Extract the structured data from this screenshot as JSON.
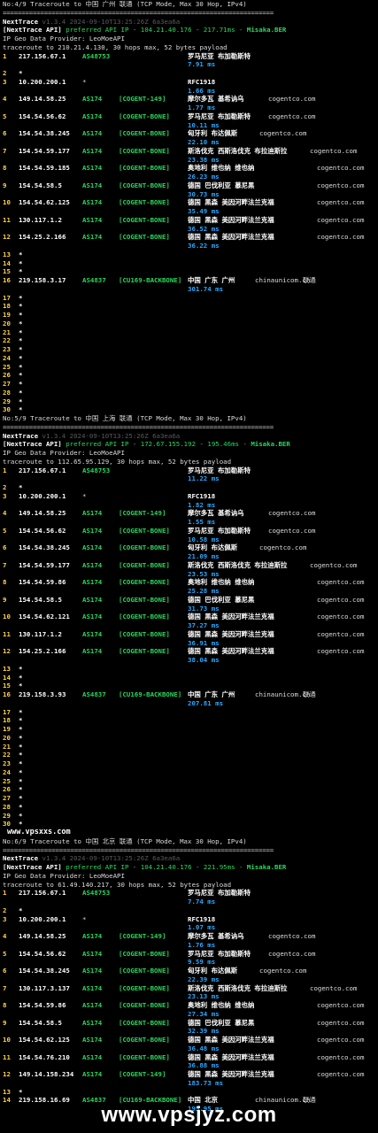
{
  "blocks": [
    {
      "header": "No:4/9 Traceroute to 中国 广州 联通 (TCP Mode, Max 30 Hop, IPv4)",
      "separator": "========================================================================",
      "title": "NextTrace",
      "version": "v1.3.4 2024-09-10T13:25:26Z 6a3ea6a",
      "api_prefix": "[NextTrace API]",
      "api_text": " preferred API IP - 104.21.40.176 - 217.71ms - ",
      "api_node": "Misaka.BER",
      "geo_provider": "IP Geo Data Provider: LeoMoeAPI",
      "trace_line": "traceroute to 210.21.4.130, 30 hops max, 52 bytes payload",
      "hops": [
        {
          "n": "1",
          "ip": "217.156.67.1",
          "as": "AS48753",
          "tag": "",
          "loc": "罗马尼亚 布加勒斯特",
          "dom": "",
          "isp": "",
          "ms": "7.91 ms"
        },
        {
          "n": "2",
          "ip": "*"
        },
        {
          "n": "3",
          "ip": "10.200.200.1",
          "as": "*",
          "tag": "",
          "loc": "RFC1918",
          "dom": "",
          "isp": "",
          "ms": "1.66 ms"
        },
        {
          "n": "4",
          "ip": "149.14.58.25",
          "as": "AS174",
          "tag": "[COGENT-149]",
          "loc": "摩尔多瓦 基希讷乌",
          "dom": "cogentco.com",
          "isp": "",
          "ms": "1.77 ms"
        },
        {
          "n": "5",
          "ip": "154.54.56.62",
          "as": "AS174",
          "tag": "[COGENT-BONE]",
          "loc": "罗马尼亚 布加勒斯特",
          "dom": "cogentco.com",
          "isp": "",
          "ms": "10.11 ms"
        },
        {
          "n": "6",
          "ip": "154.54.38.245",
          "as": "AS174",
          "tag": "[COGENT-BONE]",
          "loc": "匈牙利 布达佩斯",
          "dom": "cogentco.com",
          "isp": "",
          "ms": "22.10 ms"
        },
        {
          "n": "7",
          "ip": "154.54.59.177",
          "as": "AS174",
          "tag": "[COGENT-BONE]",
          "loc": "斯洛伐克 西斯洛伐克 布拉迪斯拉",
          "dom": "cogentco.com",
          "isp": "",
          "ms": "23.38 ms"
        },
        {
          "n": "8",
          "ip": "154.54.59.185",
          "as": "AS174",
          "tag": "[COGENT-BONE]",
          "loc": "奥地利 维也纳 维也纳",
          "dom": "cogentco.com",
          "isp": "",
          "ms": "26.23 ms"
        },
        {
          "n": "9",
          "ip": "154.54.58.5",
          "as": "AS174",
          "tag": "[COGENT-BONE]",
          "loc": "德国 巴伐利亚 慕尼黑",
          "dom": "cogentco.com",
          "isp": "",
          "ms": "30.73 ms"
        },
        {
          "n": "10",
          "ip": "154.54.62.125",
          "as": "AS174",
          "tag": "[COGENT-BONE]",
          "loc": "德国 黑森 美因河畔法兰克福",
          "dom": "cogentco.com",
          "isp": "",
          "ms": "35.49 ms"
        },
        {
          "n": "11",
          "ip": "130.117.1.2",
          "as": "AS174",
          "tag": "[COGENT-BONE]",
          "loc": "德国 黑森 美因河畔法兰克福",
          "dom": "cogentco.com",
          "isp": "",
          "ms": "36.52 ms"
        },
        {
          "n": "12",
          "ip": "154.25.2.166",
          "as": "AS174",
          "tag": "[COGENT-BONE]",
          "loc": "德国 黑森 美因河畔法兰克福",
          "dom": "cogentco.com",
          "isp": "",
          "ms": "36.22 ms"
        },
        {
          "n": "13",
          "ip": "*"
        },
        {
          "n": "14",
          "ip": "*"
        },
        {
          "n": "15",
          "ip": "*"
        },
        {
          "n": "16",
          "ip": "219.158.3.17",
          "as": "AS4837",
          "tag": "[CU169-BACKBONE]",
          "loc": "中国 广东 广州",
          "dom": "chinaunicom.cn",
          "isp": "联通",
          "ms": "301.74 ms"
        },
        {
          "n": "17",
          "ip": "*"
        },
        {
          "n": "18",
          "ip": "*"
        },
        {
          "n": "19",
          "ip": "*"
        },
        {
          "n": "20",
          "ip": "*"
        },
        {
          "n": "21",
          "ip": "*"
        },
        {
          "n": "22",
          "ip": "*"
        },
        {
          "n": "23",
          "ip": "*"
        },
        {
          "n": "24",
          "ip": "*"
        },
        {
          "n": "25",
          "ip": "*"
        },
        {
          "n": "26",
          "ip": "*"
        },
        {
          "n": "27",
          "ip": "*"
        },
        {
          "n": "28",
          "ip": "*"
        },
        {
          "n": "29",
          "ip": "*"
        },
        {
          "n": "30",
          "ip": "*"
        }
      ]
    },
    {
      "header": "No:5/9 Traceroute to 中国 上海 联通 (TCP Mode, Max 30 Hop, IPv4)",
      "separator": "========================================================================",
      "title": "NextTrace",
      "version": "v1.3.4 2024-09-10T13:25:26Z 6a3ea6a",
      "api_prefix": "[NextTrace API]",
      "api_text": " preferred API IP - 172.67.155.192 - 195.46ms - ",
      "api_node": "Misaka.BER",
      "geo_provider": "IP Geo Data Provider: LeoMoeAPI",
      "trace_line": "traceroute to 112.65.95.129, 30 hops max, 52 bytes payload",
      "hops": [
        {
          "n": "1",
          "ip": "217.156.67.1",
          "as": "AS48753",
          "tag": "",
          "loc": "罗马尼亚 布加勒斯特",
          "dom": "",
          "isp": "",
          "ms": "11.22 ms"
        },
        {
          "n": "2",
          "ip": "*"
        },
        {
          "n": "3",
          "ip": "10.200.200.1",
          "as": "*",
          "tag": "",
          "loc": "RFC1918",
          "dom": "",
          "isp": "",
          "ms": "1.82 ms"
        },
        {
          "n": "4",
          "ip": "149.14.58.25",
          "as": "AS174",
          "tag": "[COGENT-149]",
          "loc": "摩尔多瓦 基希讷乌",
          "dom": "cogentco.com",
          "isp": "",
          "ms": "1.55 ms"
        },
        {
          "n": "5",
          "ip": "154.54.56.62",
          "as": "AS174",
          "tag": "[COGENT-BONE]",
          "loc": "罗马尼亚 布加勒斯特",
          "dom": "cogentco.com",
          "isp": "",
          "ms": "10.58 ms"
        },
        {
          "n": "6",
          "ip": "154.54.38.245",
          "as": "AS174",
          "tag": "[COGENT-BONE]",
          "loc": "匈牙利 布达佩斯",
          "dom": "cogentco.com",
          "isp": "",
          "ms": "21.09 ms"
        },
        {
          "n": "7",
          "ip": "154.54.59.177",
          "as": "AS174",
          "tag": "[COGENT-BONE]",
          "loc": "斯洛伐克 西斯洛伐克 布拉迪斯拉",
          "dom": "cogentco.com",
          "isp": "",
          "ms": "23.53 ms"
        },
        {
          "n": "8",
          "ip": "154.54.59.86",
          "as": "AS174",
          "tag": "[COGENT-BONE]",
          "loc": "奥地利 维也纳 维也纳",
          "dom": "cogentco.com",
          "isp": "",
          "ms": "25.28 ms"
        },
        {
          "n": "9",
          "ip": "154.54.58.5",
          "as": "AS174",
          "tag": "[COGENT-BONE]",
          "loc": "德国 巴伐利亚 慕尼黑",
          "dom": "cogentco.com",
          "isp": "",
          "ms": "31.73 ms"
        },
        {
          "n": "10",
          "ip": "154.54.62.121",
          "as": "AS174",
          "tag": "[COGENT-BONE]",
          "loc": "德国 黑森 美因河畔法兰克福",
          "dom": "cogentco.com",
          "isp": "",
          "ms": "37.27 ms"
        },
        {
          "n": "11",
          "ip": "130.117.1.2",
          "as": "AS174",
          "tag": "[COGENT-BONE]",
          "loc": "德国 黑森 美因河畔法兰克福",
          "dom": "cogentco.com",
          "isp": "",
          "ms": "36.91 ms"
        },
        {
          "n": "12",
          "ip": "154.25.2.166",
          "as": "AS174",
          "tag": "[COGENT-BONE]",
          "loc": "德国 黑森 美因河畔法兰克福",
          "dom": "cogentco.com",
          "isp": "",
          "ms": "38.04 ms"
        },
        {
          "n": "13",
          "ip": "*"
        },
        {
          "n": "14",
          "ip": "*"
        },
        {
          "n": "15",
          "ip": "*"
        },
        {
          "n": "16",
          "ip": "219.158.3.93",
          "as": "AS4837",
          "tag": "[CU169-BACKBONE]",
          "loc": "中国 广东 广州",
          "dom": "chinaunicom.cn",
          "isp": "联通",
          "ms": "207.81 ms"
        },
        {
          "n": "17",
          "ip": "*"
        },
        {
          "n": "18",
          "ip": "*"
        },
        {
          "n": "19",
          "ip": "*"
        },
        {
          "n": "20",
          "ip": "*"
        },
        {
          "n": "21",
          "ip": "*"
        },
        {
          "n": "22",
          "ip": "*"
        },
        {
          "n": "23",
          "ip": "*"
        },
        {
          "n": "24",
          "ip": "*"
        },
        {
          "n": "25",
          "ip": "*"
        },
        {
          "n": "26",
          "ip": "*"
        },
        {
          "n": "27",
          "ip": "*"
        },
        {
          "n": "28",
          "ip": "*"
        },
        {
          "n": "29",
          "ip": "*"
        },
        {
          "n": "30",
          "ip": "*"
        }
      ]
    },
    {
      "header": "No:6/9 Traceroute to 中国 北京 联通 (TCP Mode, Max 30 Hop, IPv4)",
      "separator": "========================================================================",
      "title": "NextTrace",
      "version": "v1.3.4 2024-09-10T13:25:26Z 6a3ea6a",
      "api_prefix": "[NextTrace API]",
      "api_text": " preferred API IP - 104.21.40.176 - 221.95ms - ",
      "api_node": "Misaka.BER",
      "geo_provider": "IP Geo Data Provider: LeoMoeAPI",
      "trace_line": "traceroute to 61.49.140.217, 30 hops max, 52 bytes payload",
      "hops": [
        {
          "n": "1",
          "ip": "217.156.67.1",
          "as": "AS48753",
          "tag": "",
          "loc": "罗马尼亚 布加勒斯特",
          "dom": "",
          "isp": "",
          "ms": "7.74 ms"
        },
        {
          "n": "2",
          "ip": "*"
        },
        {
          "n": "3",
          "ip": "10.200.200.1",
          "as": "*",
          "tag": "",
          "loc": "RFC1918",
          "dom": "",
          "isp": "",
          "ms": "1.07 ms"
        },
        {
          "n": "4",
          "ip": "149.14.58.25",
          "as": "AS174",
          "tag": "[COGENT-149]",
          "loc": "摩尔多瓦 基希讷乌",
          "dom": "cogentco.com",
          "isp": "",
          "ms": "1.76 ms"
        },
        {
          "n": "5",
          "ip": "154.54.56.62",
          "as": "AS174",
          "tag": "[COGENT-BONE]",
          "loc": "罗马尼亚 布加勒斯特",
          "dom": "cogentco.com",
          "isp": "",
          "ms": "9.59 ms"
        },
        {
          "n": "6",
          "ip": "154.54.38.245",
          "as": "AS174",
          "tag": "[COGENT-BONE]",
          "loc": "匈牙利 布达佩斯",
          "dom": "cogentco.com",
          "isp": "",
          "ms": "22.39 ms"
        },
        {
          "n": "7",
          "ip": "130.117.3.137",
          "as": "AS174",
          "tag": "[COGENT-BONE]",
          "loc": "斯洛伐克 西斯洛伐克 布拉迪斯拉",
          "dom": "cogentco.com",
          "isp": "",
          "ms": "23.13 ms"
        },
        {
          "n": "8",
          "ip": "154.54.59.86",
          "as": "AS174",
          "tag": "[COGENT-BONE]",
          "loc": "奥地利 维也纳 维也纳",
          "dom": "cogentco.com",
          "isp": "",
          "ms": "27.34 ms"
        },
        {
          "n": "9",
          "ip": "154.54.58.5",
          "as": "AS174",
          "tag": "[COGENT-BONE]",
          "loc": "德国 巴伐利亚 慕尼黑",
          "dom": "cogentco.com",
          "isp": "",
          "ms": "32.39 ms"
        },
        {
          "n": "10",
          "ip": "154.54.62.125",
          "as": "AS174",
          "tag": "[COGENT-BONE]",
          "loc": "德国 黑森 美因河畔法兰克福",
          "dom": "cogentco.com",
          "isp": "",
          "ms": "36.48 ms"
        },
        {
          "n": "11",
          "ip": "154.54.76.210",
          "as": "AS174",
          "tag": "[COGENT-BONE]",
          "loc": "德国 黑森 美因河畔法兰克福",
          "dom": "cogentco.com",
          "isp": "",
          "ms": "36.88 ms"
        },
        {
          "n": "12",
          "ip": "149.14.158.234",
          "as": "AS174",
          "tag": "[COGENT-149]",
          "loc": "德国 黑森 美因河畔法兰克福",
          "dom": "cogentco.com",
          "isp": "",
          "ms": "183.73 ms"
        },
        {
          "n": "13",
          "ip": "*"
        },
        {
          "n": "14",
          "ip": "219.158.16.69",
          "as": "AS4837",
          "tag": "[CU169-BACKBONE]",
          "loc": "中国 北京",
          "dom": "chinaunicom.cn",
          "isp": "联通",
          "ms": "195.95 ms"
        }
      ]
    }
  ],
  "site_label": "www.vpsxxs.com",
  "watermark": "www.vpsjyz.com"
}
